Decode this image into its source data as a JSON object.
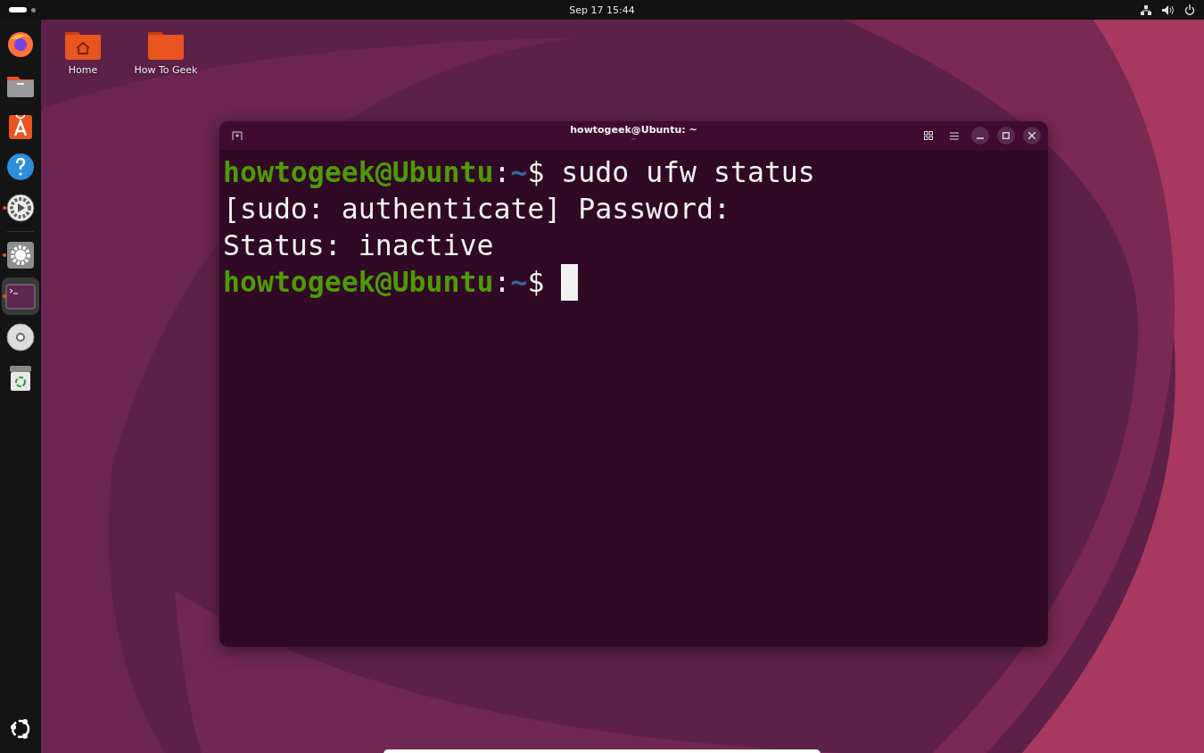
{
  "top_bar": {
    "clock": "Sep 17  15:44"
  },
  "dock": {
    "items": [
      {
        "kind": "browser",
        "running": false,
        "selected": false
      },
      {
        "kind": "files",
        "running": false,
        "selected": false
      },
      {
        "kind": "store",
        "running": false,
        "selected": false
      },
      {
        "kind": "help",
        "running": false,
        "selected": false
      },
      {
        "kind": "updater",
        "running": true,
        "selected": false
      },
      {
        "kind": "divider"
      },
      {
        "kind": "settings",
        "running": true,
        "selected": false
      },
      {
        "kind": "terminal",
        "running": true,
        "selected": true
      },
      {
        "kind": "disc",
        "running": false,
        "selected": false
      },
      {
        "kind": "trash",
        "running": false,
        "selected": false
      }
    ]
  },
  "desktop_icons": [
    {
      "label": "Home",
      "kind": "home"
    },
    {
      "label": "How To Geek",
      "kind": "folder"
    }
  ],
  "terminal": {
    "title": "howtogeek@Ubuntu: ~",
    "subtitle": "~",
    "lines": [
      {
        "segments": [
          {
            "kind": "user",
            "text": "howtogeek@Ubuntu"
          },
          {
            "kind": "plain",
            "text": ":"
          },
          {
            "kind": "path",
            "text": "~"
          },
          {
            "kind": "plain",
            "text": "$ sudo ufw status"
          }
        ],
        "cursor": false
      },
      {
        "segments": [
          {
            "kind": "plain",
            "text": "[sudo: authenticate] Password:"
          }
        ],
        "cursor": false
      },
      {
        "segments": [
          {
            "kind": "plain",
            "text": "Status: inactive"
          }
        ],
        "cursor": false
      },
      {
        "segments": [
          {
            "kind": "user",
            "text": "howtogeek@Ubuntu"
          },
          {
            "kind": "plain",
            "text": ":"
          },
          {
            "kind": "path",
            "text": "~"
          },
          {
            "kind": "plain",
            "text": "$ "
          }
        ],
        "cursor": true
      }
    ]
  }
}
